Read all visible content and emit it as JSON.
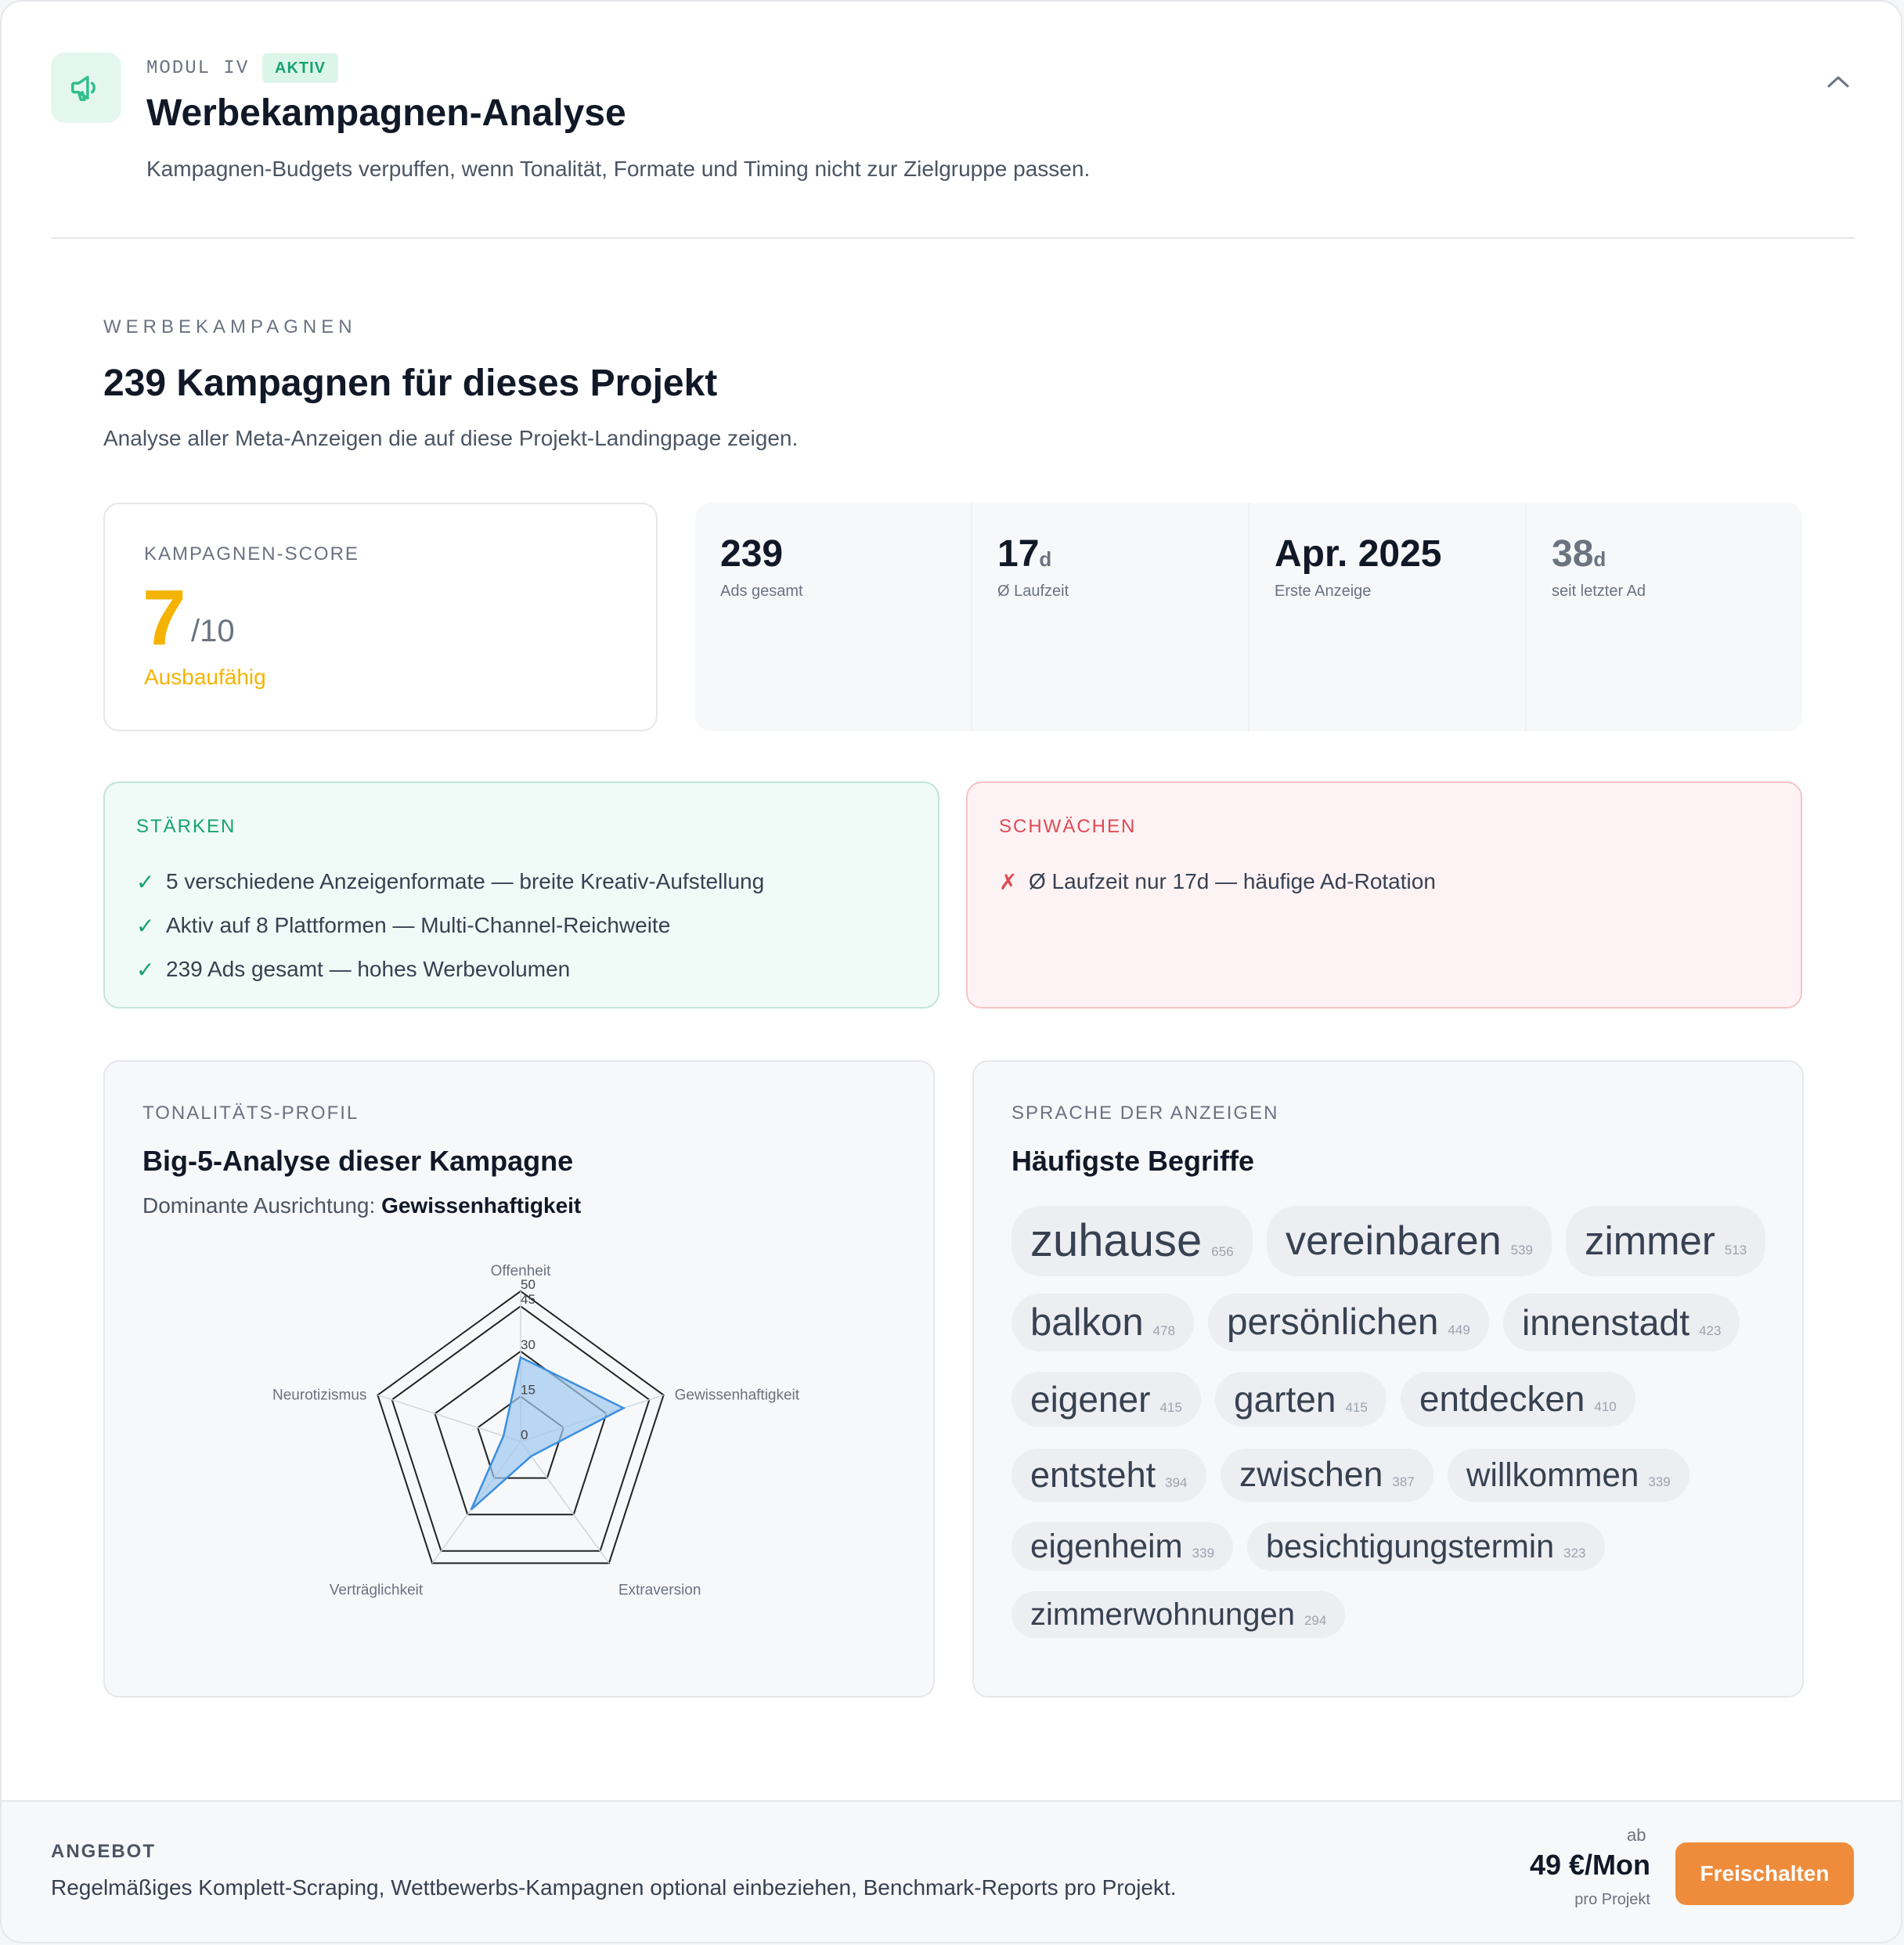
{
  "header": {
    "modul": "MODUL IV",
    "badge": "AKTIV",
    "title": "Werbekampagnen-Analyse",
    "description": "Kampagnen-Budgets verpuffen, wenn Tonalität, Formate und Timing nicht zur Zielgruppe passen."
  },
  "section": {
    "eyebrow": "WERBEKAMPAGNEN",
    "title": "239 Kampagnen für dieses Projekt",
    "subtitle": "Analyse aller Meta-Anzeigen die auf diese Projekt-Landingpage zeigen."
  },
  "score": {
    "label": "KAMPAGNEN-SCORE",
    "value": "7",
    "max": "/10",
    "rating": "Ausbaufähig",
    "color": "#f5b301"
  },
  "stats": [
    {
      "value": "239",
      "unit": "",
      "label": "Ads gesamt"
    },
    {
      "value": "17",
      "unit": "d",
      "label": "Ø Laufzeit"
    },
    {
      "value": "Apr. 2025",
      "unit": "",
      "label": "Erste Anzeige"
    },
    {
      "value": "38",
      "unit": "d",
      "label": "seit letzter Ad"
    }
  ],
  "strengths": {
    "label": "STÄRKEN",
    "mark": "✓",
    "items": [
      "5 verschiedene Anzeigenformate — breite Kreativ-Aufstellung",
      "Aktiv auf 8 Plattformen — Multi-Channel-Reichweite",
      "239 Ads gesamt — hohes Werbevolumen"
    ]
  },
  "weaknesses": {
    "label": "SCHWÄCHEN",
    "mark": "✗",
    "items": [
      "Ø Laufzeit nur 17d — häufige Ad-Rotation"
    ]
  },
  "tonality": {
    "eyebrow": "TONALITÄTS-PROFIL",
    "title": "Big-5-Analyse dieser Kampagne",
    "dominant_prefix": "Dominante Ausrichtung: ",
    "dominant": "Gewissenhaftigkeit"
  },
  "chart_data": {
    "type": "radar",
    "categories": [
      "Offenheit",
      "Gewissenhaftigkeit",
      "Extraversion",
      "Verträglichkeit",
      "Neurotizismus"
    ],
    "values": [
      28,
      36,
      6,
      28,
      6
    ],
    "rlim": [
      0,
      50
    ],
    "tick_labels": [
      "0",
      "15",
      "30",
      "45",
      "50"
    ],
    "fill_color": "#9ec8ee",
    "line_color": "#3b8fe0",
    "grid": true
  },
  "words": {
    "eyebrow": "SPRACHE DER ANZEIGEN",
    "title": "Häufigste Begriffe",
    "items": [
      {
        "word": "zuhause",
        "count": "656"
      },
      {
        "word": "vereinbaren",
        "count": "539"
      },
      {
        "word": "zimmer",
        "count": "513"
      },
      {
        "word": "balkon",
        "count": "478"
      },
      {
        "word": "persönlichen",
        "count": "449"
      },
      {
        "word": "innenstadt",
        "count": "423"
      },
      {
        "word": "eigener",
        "count": "415"
      },
      {
        "word": "garten",
        "count": "415"
      },
      {
        "word": "entdecken",
        "count": "410"
      },
      {
        "word": "entsteht",
        "count": "394"
      },
      {
        "word": "zwischen",
        "count": "387"
      },
      {
        "word": "willkommen",
        "count": "339"
      },
      {
        "word": "eigenheim",
        "count": "339"
      },
      {
        "word": "besichtigungstermin",
        "count": "323"
      },
      {
        "word": "zimmerwohnungen",
        "count": "294"
      }
    ]
  },
  "footer": {
    "label": "ANGEBOT",
    "text": "Regelmäßiges Komplett-Scraping, Wettbewerbs-Kampagnen optional einbeziehen, Benchmark-Reports pro Projekt.",
    "price_prefix": "ab",
    "price": "49 €/Mon",
    "price_suffix": "pro Projekt",
    "cta": "Freischalten",
    "cta_color": "#ee8c3c"
  },
  "icons": {
    "header": "megaphone-icon",
    "collapse": "chevron-up-icon"
  }
}
